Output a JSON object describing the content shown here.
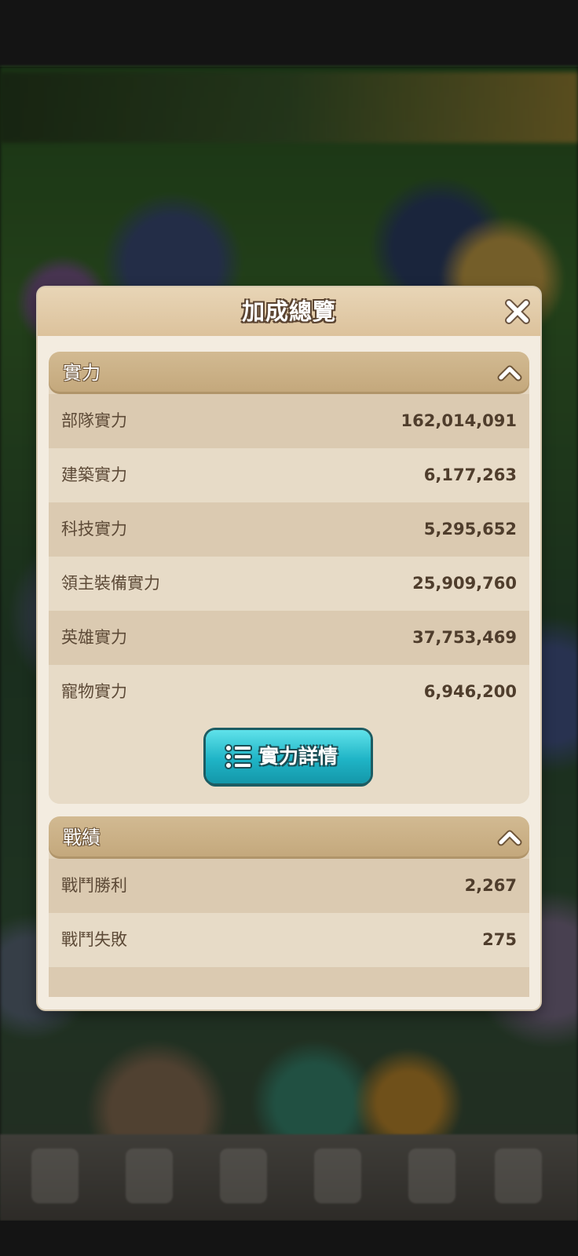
{
  "dialog": {
    "title": "加成總覽",
    "close_icon": "close-x-icon"
  },
  "sections": [
    {
      "title": "實力",
      "expanded": true,
      "rows": [
        {
          "label": "部隊實力",
          "value": "162,014,091"
        },
        {
          "label": "建築實力",
          "value": "6,177,263"
        },
        {
          "label": "科技實力",
          "value": "5,295,652"
        },
        {
          "label": "領主裝備實力",
          "value": "25,909,760"
        },
        {
          "label": "英雄實力",
          "value": "37,753,469"
        },
        {
          "label": "寵物實力",
          "value": "6,946,200"
        }
      ],
      "button": {
        "label": "實力詳情",
        "icon": "list-icon"
      }
    },
    {
      "title": "戰績",
      "expanded": true,
      "rows": [
        {
          "label": "戰鬥勝利",
          "value": "2,267"
        },
        {
          "label": "戰鬥失敗",
          "value": "275"
        }
      ]
    }
  ],
  "colors": {
    "dialog_bg": "#f3ece0",
    "header_bg": "#dcc29c",
    "section_header": "#c3a77b",
    "button_accent": "#1fb4c6",
    "text_dark": "#4f3d2c"
  }
}
